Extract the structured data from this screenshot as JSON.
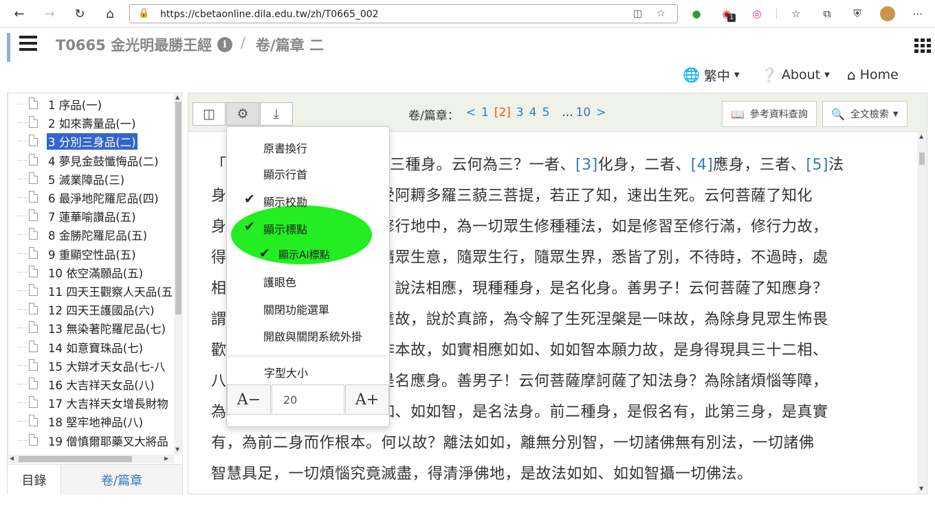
{
  "browser": {
    "url": "https://cbetaonline.dila.edu.tw/zh/T0665_002",
    "ext_badge": "1"
  },
  "header": {
    "title": "T0665 金光明最勝王經",
    "separator": "/",
    "juan_title": "卷/篇章 二",
    "info_glyph": "i"
  },
  "top_menu": {
    "language": "繁中",
    "about": "About",
    "home": "Home"
  },
  "sidebar": {
    "items": [
      {
        "label": "1 序品(一)"
      },
      {
        "label": "2 如來壽量品(一)"
      },
      {
        "label": "3 分別三身品(二)"
      },
      {
        "label": "4 夢見金鼓懺悔品(二)"
      },
      {
        "label": "5 滅業障品(三)"
      },
      {
        "label": "6 最淨地陀羅尼品(四)"
      },
      {
        "label": "7 蓮華喻讚品(五)"
      },
      {
        "label": "8 金勝陀羅尼品(五)"
      },
      {
        "label": "9 重顯空性品(五)"
      },
      {
        "label": "10 依空滿願品(五)"
      },
      {
        "label": "11 四天王觀察人天品(五"
      },
      {
        "label": "12 四天王護國品(六)"
      },
      {
        "label": "13 無染著陀羅尼品(七)"
      },
      {
        "label": "14 如意寶珠品(七)"
      },
      {
        "label": "15 大辯才天女品(七-八"
      },
      {
        "label": "16 大吉祥天女品(八)"
      },
      {
        "label": "17 大吉祥天女增長財物"
      },
      {
        "label": "18 堅牢地神品(八)"
      },
      {
        "label": "19 僧慎爾耶藥叉大將品"
      }
    ],
    "tabs": {
      "catalog": "目錄",
      "juan": "卷/篇章"
    }
  },
  "toolbar": {
    "juan_label": "卷/篇章：",
    "prev": "<",
    "pages": [
      "1",
      "[2]",
      "3",
      "4",
      "5"
    ],
    "ellipsis": "...",
    "last": "10",
    "next": ">",
    "reference": "參考資料查詢",
    "fulltext": "全文檢索"
  },
  "dropdown": {
    "items": [
      "原書換行",
      "顯示行首",
      "顯示校勘",
      "顯示標點",
      "顯示AI標點",
      "護眼色",
      "關閉功能選單",
      "開啟與關閉系統外掛"
    ],
    "font_size_label": "字型大小",
    "font_minus": "A−",
    "font_plus": "A+",
    "font_size_value": "20",
    "highlight_color": "#22ee22"
  },
  "content": {
    "lines": [
      {
        "p1": "「",
        "p2": "",
        "hidden_mid": "",
        "tail": "三種身。云何為三？一者、",
        "n1": "[3]",
        "t1": "化身，二者、",
        "n2": "[4]",
        "t2": "應身，三者、",
        "n3": "[5]",
        "t3": "法"
      },
      {
        "p1": "身",
        "tail": "受阿耨多羅三藐三菩提，若正了知，速出生死。云何菩薩了知化"
      },
      {
        "p1": "身",
        "tail": "修行地中，為一切眾生修種種法，如是修習至修行滿，修行力故，"
      },
      {
        "p1": "得",
        "tail": "隨眾生意，隨眾生行，隨眾生界，悉皆了別，不待時，不過時，處"
      },
      {
        "p1": "相",
        "tail": "，說法相應，現種種身，是名化身。善男子！云何菩薩了知應身？"
      },
      {
        "p1": "謂",
        "tail": "達故，說於真諦，為令解了生死涅槃是一味故，為除身見眾生怖畏"
      },
      {
        "p1": "歡",
        "tail": "作本故，如實相應如如、如如智本願力故，是身得現具三十二相、"
      },
      {
        "p1": "八",
        "tail": "是名應身。善男子！云何菩薩摩訶薩了知法身？為除諸煩惱等障，"
      },
      {
        "p1": "為",
        "tail": "如、如如智，是名法身。前二種身，是假名有，此第三身，是真實"
      },
      {
        "p1": "",
        "tail": "有，為前二身而作根本。何以故？離法如如，離無分別智，一切諸佛無有別法，一切諸佛"
      },
      {
        "p1": "",
        "tail": "智慧具足，一切煩惱究竟滅盡，得清淨佛地，是故法如如、如如智攝一切佛法。"
      }
    ]
  }
}
